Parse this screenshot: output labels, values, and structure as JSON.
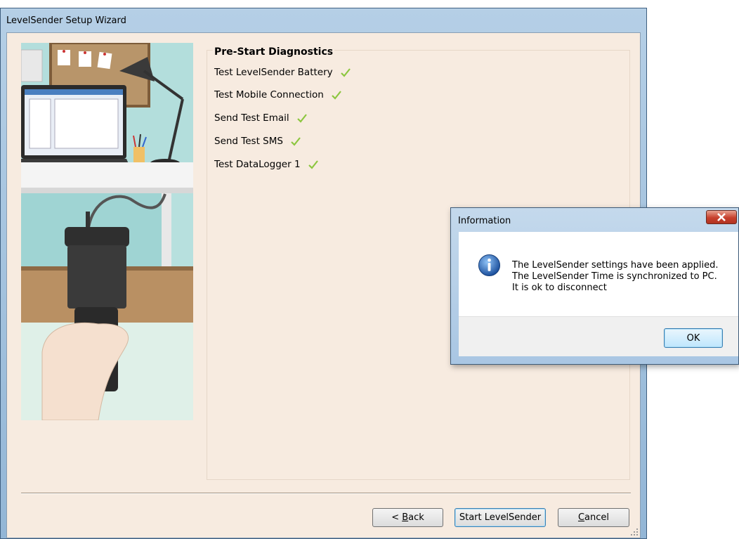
{
  "window": {
    "title": "LevelSender Setup Wizard"
  },
  "diagnostics": {
    "heading": "Pre-Start Diagnostics",
    "items": [
      {
        "label": "Test LevelSender Battery",
        "status": "passed"
      },
      {
        "label": "Test Mobile Connection",
        "status": "passed"
      },
      {
        "label": "Send Test Email",
        "status": "passed"
      },
      {
        "label": "Send Test SMS",
        "status": "passed"
      },
      {
        "label": "Test DataLogger 1",
        "status": "passed"
      }
    ],
    "check_color": "#8cc63f"
  },
  "buttons": {
    "back_prefix": "< ",
    "back_mnemonic": "B",
    "back_rest": "ack",
    "start": "Start LevelSender",
    "cancel_mnemonic": "C",
    "cancel_rest": "ancel"
  },
  "dialog": {
    "title": "Information",
    "icon": "info-icon",
    "message_lines": [
      "The LevelSender settings have been applied.",
      "The LevelSender Time is synchronized to PC.",
      "It is ok to disconnect"
    ],
    "ok_label": "OK"
  },
  "colors": {
    "client_bg": "#f7ebe0",
    "frame": "#a9c6e3",
    "close_button": "#c7402d"
  }
}
